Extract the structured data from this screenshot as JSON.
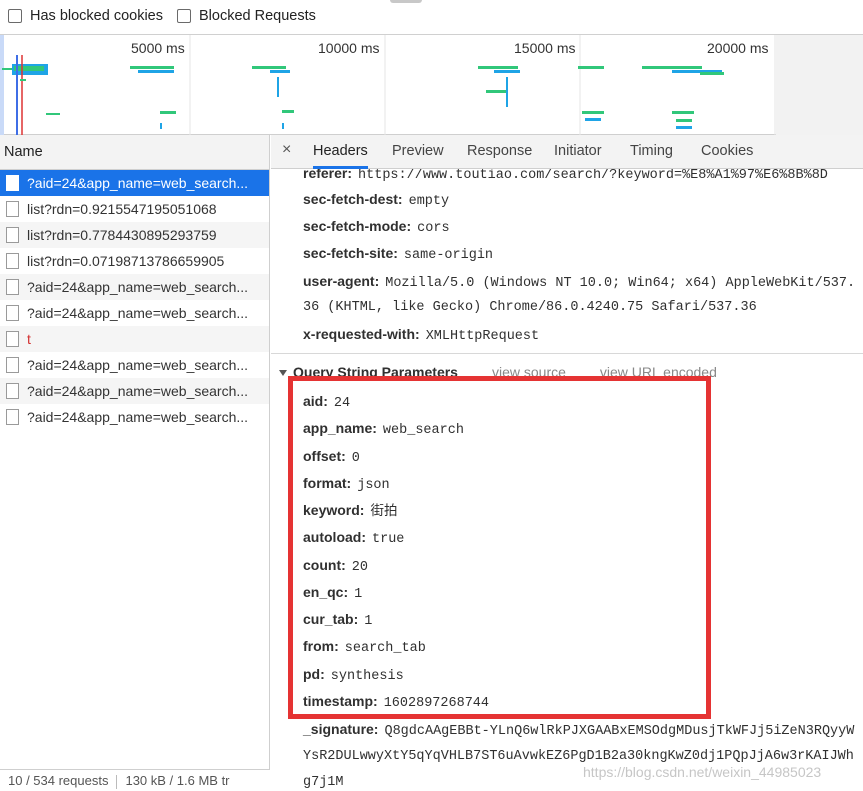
{
  "filter": {
    "has_blocked_cookies": "Has blocked cookies",
    "blocked_requests": "Blocked Requests"
  },
  "overview": {
    "ticks": [
      "5000 ms",
      "10000 ms",
      "15000 ms",
      "20000 ms"
    ]
  },
  "requests": {
    "header": "Name",
    "items": [
      {
        "name": "?aid=24&app_name=web_search...",
        "selected": true
      },
      {
        "name": "list?rdn=0.9215547195051068"
      },
      {
        "name": "list?rdn=0.7784430895293759"
      },
      {
        "name": "list?rdn=0.07198713786659905"
      },
      {
        "name": "?aid=24&app_name=web_search..."
      },
      {
        "name": "?aid=24&app_name=web_search..."
      },
      {
        "name": "t",
        "error": true
      },
      {
        "name": "?aid=24&app_name=web_search..."
      },
      {
        "name": "?aid=24&app_name=web_search..."
      },
      {
        "name": "?aid=24&app_name=web_search..."
      }
    ],
    "status_count": "10 / 534 requests",
    "status_size": "130 kB / 1.6 MB tr"
  },
  "tabs": {
    "close": "×",
    "items": [
      "Headers",
      "Preview",
      "Response",
      "Initiator",
      "Timing",
      "Cookies"
    ],
    "active": "Headers"
  },
  "headers": {
    "referer_key": "referer:",
    "referer_val": "https://www.toutiao.com/search/?keyword=%E8%A1%97%E6%8B%8D",
    "sec_fetch_dest_key": "sec-fetch-dest:",
    "sec_fetch_dest_val": "empty",
    "sec_fetch_mode_key": "sec-fetch-mode:",
    "sec_fetch_mode_val": "cors",
    "sec_fetch_site_key": "sec-fetch-site:",
    "sec_fetch_site_val": "same-origin",
    "user_agent_key": "user-agent:",
    "user_agent_val": "Mozilla/5.0 (Windows NT 10.0; Win64; x64) AppleWebKit/537.",
    "user_agent_cont": "36 (KHTML, like Gecko) Chrome/86.0.4240.75 Safari/537.36",
    "x_requested_with_key": "x-requested-with:",
    "x_requested_with_val": "XMLHttpRequest"
  },
  "query": {
    "title": "Query String Parameters",
    "view_source": "view source",
    "view_url_encoded": "view URL encoded",
    "params": [
      {
        "key": "aid:",
        "value": "24"
      },
      {
        "key": "app_name:",
        "value": "web_search"
      },
      {
        "key": "offset:",
        "value": "0"
      },
      {
        "key": "format:",
        "value": "json"
      },
      {
        "key": "keyword:",
        "value": "街拍"
      },
      {
        "key": "autoload:",
        "value": "true"
      },
      {
        "key": "count:",
        "value": "20"
      },
      {
        "key": "en_qc:",
        "value": "1"
      },
      {
        "key": "cur_tab:",
        "value": "1"
      },
      {
        "key": "from:",
        "value": "search_tab"
      },
      {
        "key": "pd:",
        "value": "synthesis"
      },
      {
        "key": "timestamp:",
        "value": "1602897268744"
      }
    ],
    "signature_key": "_signature:",
    "signature_val": "Q8gdcAAgEBBt-YLnQ6wlRkPJXGAABxEMSOdgMDusjTkWFJj5iZeN3RQyyW",
    "signature_cont1": "YsR2DULwwyXtY5qYqVHLB7ST6uAvwkEZ6PgD1B2a30kngKwZ0dj1PQpJjA6w3rKAIJWh",
    "signature_cont2": "g7j1M"
  },
  "watermark": "https://blog.csdn.net/weixin_44985023",
  "colors": {
    "selected": "#1a73e8",
    "highlight_box": "#e53333",
    "error_text": "#d32f2f"
  }
}
